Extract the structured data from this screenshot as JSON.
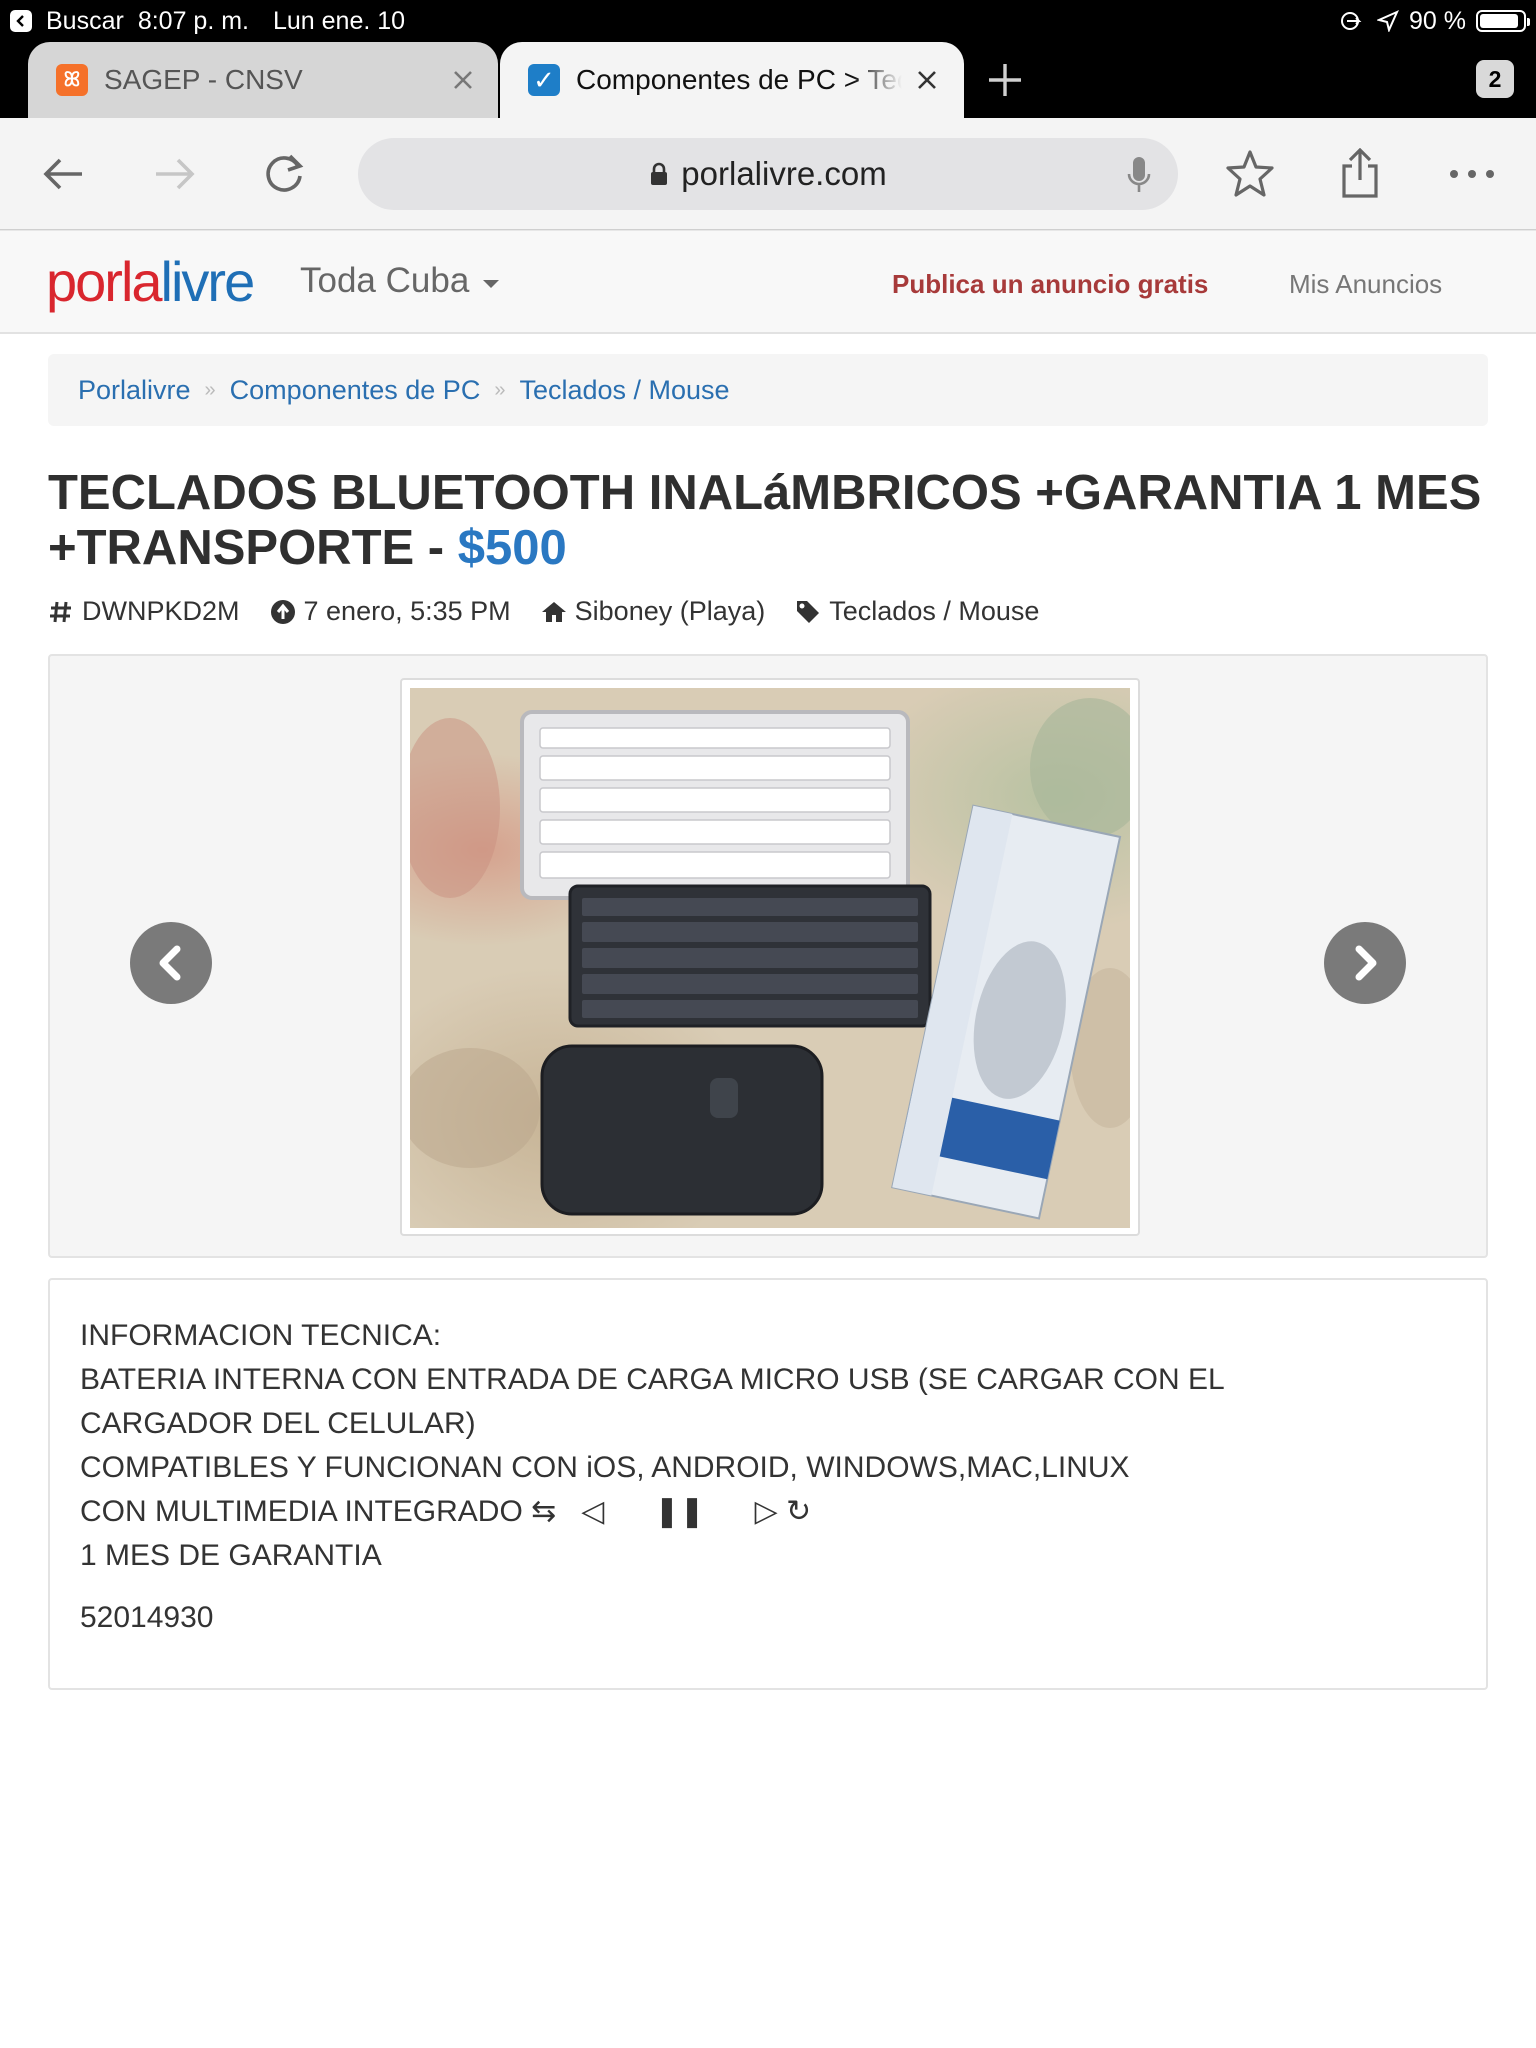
{
  "status_bar": {
    "back_app": "Buscar",
    "time": "8:07 p. m.",
    "date": "Lun ene. 10",
    "battery": "90 %",
    "battery_level": 0.9
  },
  "tabs": [
    {
      "title": "SAGEP - CNSV",
      "active": false
    },
    {
      "title": "Componentes de PC > Teclados / Mouse",
      "active": true
    }
  ],
  "tab_count": "2",
  "toolbar": {
    "url": "porlalivre.com"
  },
  "site": {
    "logo_part1": "porla",
    "logo_part2": "livre",
    "region": "Toda Cuba",
    "publish": "Publica un anuncio gratis",
    "my_ads": "Mis Anuncios"
  },
  "breadcrumb": {
    "items": [
      "Porlalivre",
      "Componentes de PC",
      "Teclados / Mouse"
    ],
    "separator": "»"
  },
  "ad": {
    "title": "TECLADOS BLUETOOTH INALáMBRICOS +GARANTIA 1 MES +TRANSPORTE - ",
    "price": "$500",
    "id": "DWNPKD2M",
    "date": "7 enero, 5:35 PM",
    "location": "Siboney (Playa)",
    "category": "Teclados / Mouse",
    "description_lines": [
      "INFORMACION TECNICA:",
      "BATERIA INTERNA CON ENTRADA DE CARGA MICRO USB (SE CARGAR CON EL",
      "CARGADOR DEL CELULAR)",
      "COMPATIBLES Y FUNCIONAN CON iOS, ANDROID, WINDOWS,MAC,LINUX",
      "CON MULTIMEDIA INTEGRADO ⇆   ◁      ❚❚      ▷ ↻",
      "1 MES DE GARANTIA"
    ],
    "phone": "52014930"
  }
}
